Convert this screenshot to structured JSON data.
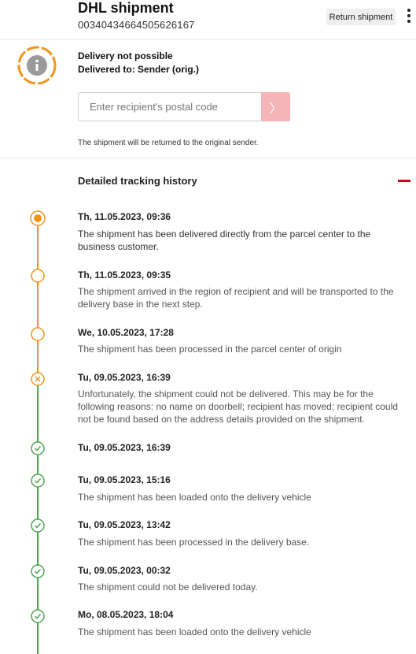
{
  "header": {
    "title": "DHL shipment",
    "tracking_number": "00340434664505626167",
    "return_button_label": "Return shipment"
  },
  "status": {
    "headline": "Delivery not possible",
    "delivered_to": "Delivered to:  Sender (orig.)",
    "postal_placeholder": "Enter recipient's postal code",
    "submit_glyph": "〉",
    "note": "The shipment will be returned to the original sender."
  },
  "history": {
    "title": "Detailed tracking history",
    "events": [
      {
        "date": "Th, 11.05.2023, 09:36",
        "status": "delivered",
        "desc": "The shipment has been delivered directly from the parcel center to the business customer."
      },
      {
        "date": "Th, 11.05.2023, 09:35",
        "status": "open",
        "desc": "The shipment arrived in the region of recipient and will be transported to the delivery base in the next step."
      },
      {
        "date": "We, 10.05.2023, 17:28",
        "status": "open",
        "desc": "The shipment has been processed in the parcel center of origin"
      },
      {
        "date": "Tu, 09.05.2023, 16:39",
        "status": "failed",
        "desc": "Unfortunately, the shipment could not be delivered. This may be for the following reasons: no name on doorbell; recipient has moved; recipient could not be found based on the address details provided on the shipment."
      },
      {
        "date": "Tu, 09.05.2023, 16:39",
        "status": "done",
        "desc": ""
      },
      {
        "date": "Tu, 09.05.2023, 15:16",
        "status": "done",
        "desc": "The shipment has been loaded onto the delivery vehicle"
      },
      {
        "date": "Tu, 09.05.2023, 13:42",
        "status": "done",
        "desc": "The shipment has been processed in the delivery base."
      },
      {
        "date": "Tu, 09.05.2023, 00:32",
        "status": "done",
        "desc": "The shipment could not be delivered today."
      },
      {
        "date": "Mo, 08.05.2023, 18:04",
        "status": "done",
        "desc": "The shipment has been loaded onto the delivery vehicle"
      }
    ]
  },
  "colors": {
    "orange": "#f0941c",
    "green": "#4ea54e",
    "red": "#d40511",
    "grey_icon": "#9a9a9a"
  }
}
